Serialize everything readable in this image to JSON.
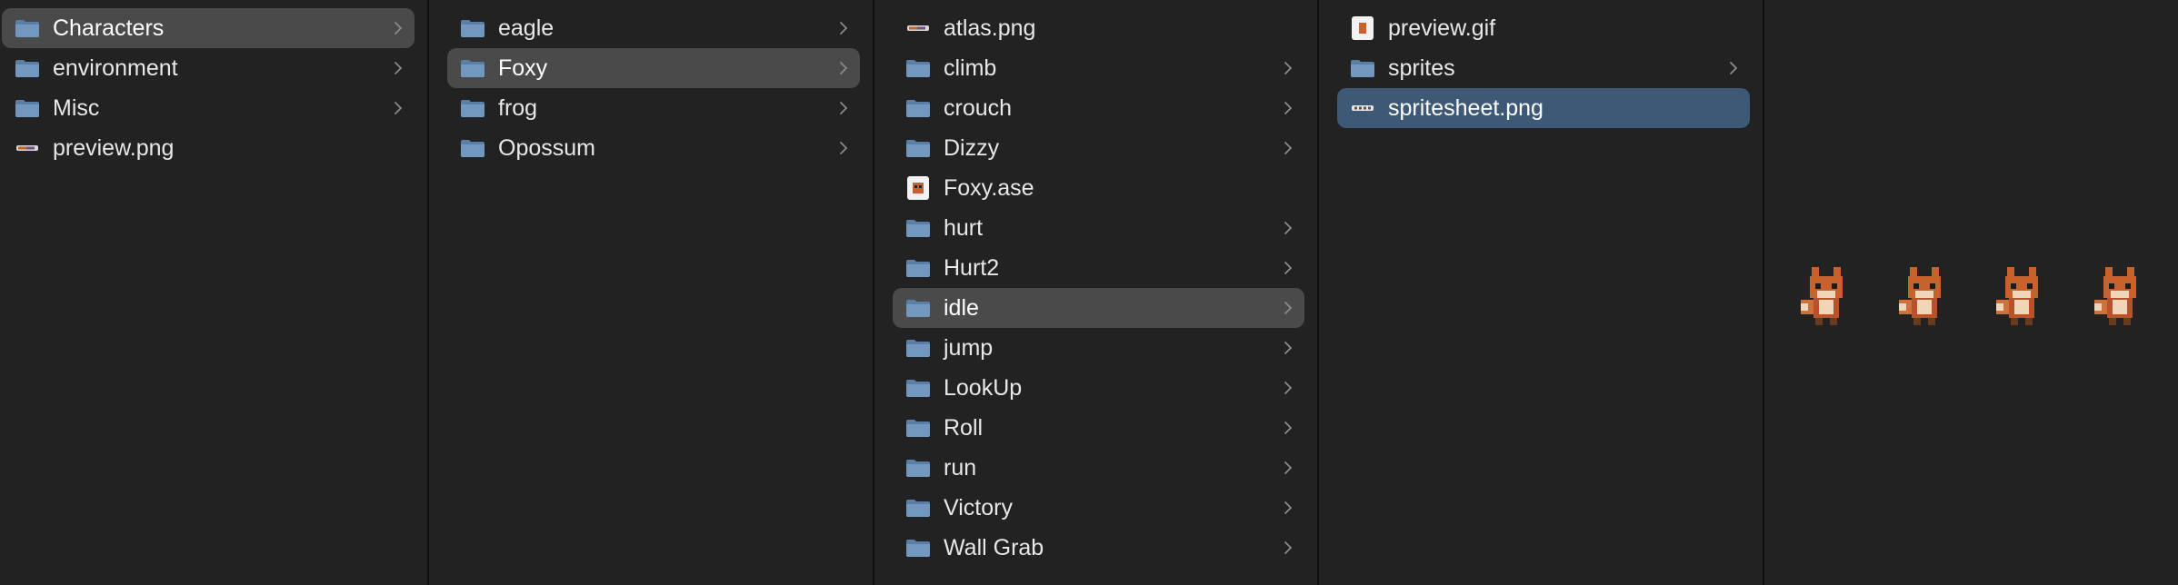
{
  "columns": [
    {
      "items": [
        {
          "label": "Characters",
          "icon": "folder-icon",
          "chevron": true,
          "selected": "gray"
        },
        {
          "label": "environment",
          "icon": "folder-icon",
          "chevron": true
        },
        {
          "label": "Misc",
          "icon": "folder-icon",
          "chevron": true
        },
        {
          "label": "preview.png",
          "icon": "png-file-icon",
          "chevron": false
        }
      ]
    },
    {
      "items": [
        {
          "label": "eagle",
          "icon": "folder-icon",
          "chevron": true
        },
        {
          "label": "Foxy",
          "icon": "folder-icon",
          "chevron": true,
          "selected": "gray"
        },
        {
          "label": "frog",
          "icon": "folder-icon",
          "chevron": true
        },
        {
          "label": "Opossum",
          "icon": "folder-icon",
          "chevron": true
        }
      ]
    },
    {
      "items": [
        {
          "label": "atlas.png",
          "icon": "png-file-icon",
          "chevron": false
        },
        {
          "label": "climb",
          "icon": "folder-icon",
          "chevron": true
        },
        {
          "label": "crouch",
          "icon": "folder-icon",
          "chevron": true
        },
        {
          "label": "Dizzy",
          "icon": "folder-icon",
          "chevron": true
        },
        {
          "label": "Foxy.ase",
          "icon": "ase-file-icon",
          "chevron": false
        },
        {
          "label": "hurt",
          "icon": "folder-icon",
          "chevron": true
        },
        {
          "label": "Hurt2",
          "icon": "folder-icon",
          "chevron": true
        },
        {
          "label": "idle",
          "icon": "folder-icon",
          "chevron": true,
          "selected": "gray"
        },
        {
          "label": "jump",
          "icon": "folder-icon",
          "chevron": true
        },
        {
          "label": "LookUp",
          "icon": "folder-icon",
          "chevron": true
        },
        {
          "label": "Roll",
          "icon": "folder-icon",
          "chevron": true
        },
        {
          "label": "run",
          "icon": "folder-icon",
          "chevron": true
        },
        {
          "label": "Victory",
          "icon": "folder-icon",
          "chevron": true
        },
        {
          "label": "Wall Grab",
          "icon": "folder-icon",
          "chevron": true
        }
      ]
    },
    {
      "items": [
        {
          "label": "preview.gif",
          "icon": "gif-file-icon",
          "chevron": false
        },
        {
          "label": "sprites",
          "icon": "folder-icon",
          "chevron": true
        },
        {
          "label": "spritesheet.png",
          "icon": "spritesheet-file-icon",
          "chevron": false,
          "selected": "blue"
        }
      ]
    }
  ],
  "preview": {
    "frames": [
      "fox-sprite-icon",
      "fox-sprite-icon",
      "fox-sprite-icon",
      "fox-sprite-icon"
    ]
  },
  "colors": {
    "background": "#222222",
    "selected_gray": "#4a4a4a",
    "selected_blue": "#3e5976",
    "folder_blue": "#6b8fb5",
    "fox_orange": "#c8622c"
  }
}
